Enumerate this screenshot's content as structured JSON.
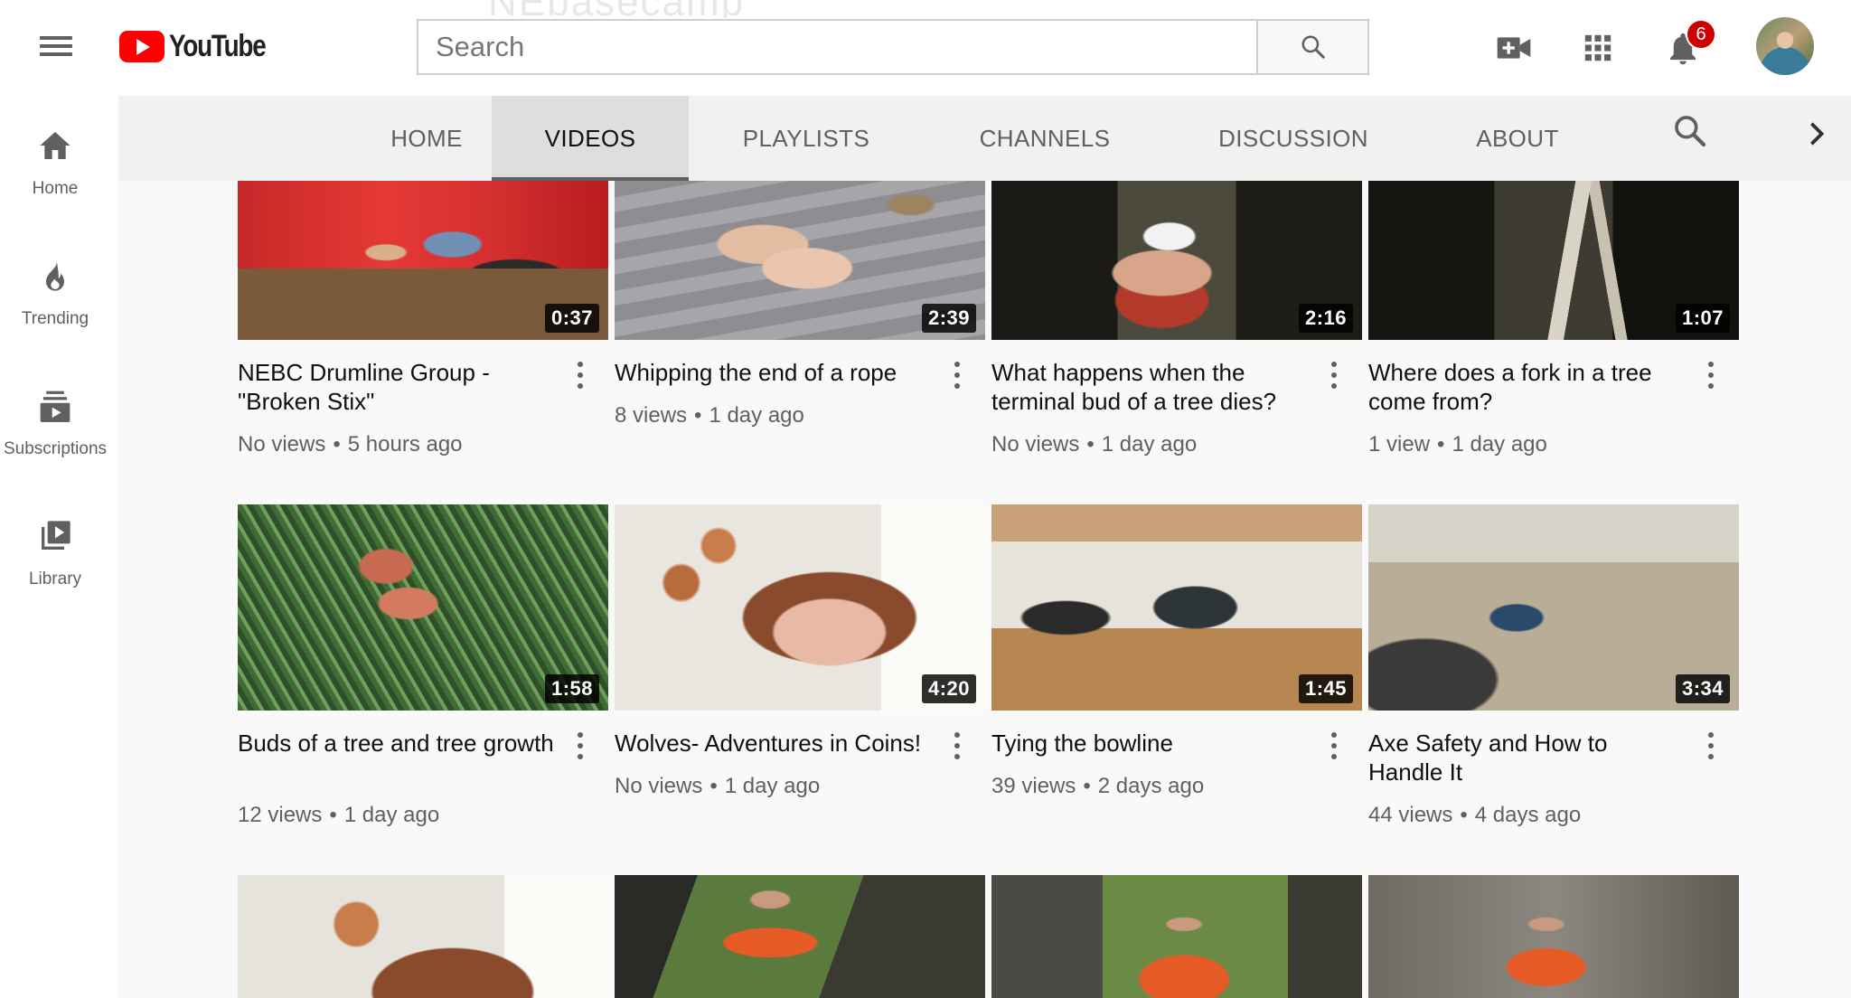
{
  "app": {
    "logo_text": "YouTube",
    "banner_ghost": "NEbasecamp"
  },
  "search": {
    "placeholder": "Search"
  },
  "notifications": {
    "count": "6"
  },
  "guide": [
    {
      "label": "Home",
      "icon": "home-icon"
    },
    {
      "label": "Trending",
      "icon": "trending-icon"
    },
    {
      "label": "Subscriptions",
      "icon": "subscriptions-icon"
    },
    {
      "label": "Library",
      "icon": "library-icon"
    }
  ],
  "tabs": [
    {
      "label": "HOME",
      "active": false
    },
    {
      "label": "VIDEOS",
      "active": true
    },
    {
      "label": "PLAYLISTS",
      "active": false
    },
    {
      "label": "CHANNELS",
      "active": false
    },
    {
      "label": "DISCUSSION",
      "active": false
    },
    {
      "label": "ABOUT",
      "active": false
    }
  ],
  "videos": [
    {
      "title": "NEBC Drumline Group - \"Broken Stix\"",
      "duration": "0:37",
      "views": "No views",
      "age": "5 hours ago"
    },
    {
      "title": "Whipping the end of a rope",
      "duration": "2:39",
      "views": "8 views",
      "age": "1 day ago"
    },
    {
      "title": "What happens when the terminal bud of a tree dies?",
      "duration": "2:16",
      "views": "No views",
      "age": "1 day ago"
    },
    {
      "title": "Where does a fork in a tree come from?",
      "duration": "1:07",
      "views": "1 view",
      "age": "1 day ago"
    },
    {
      "title": "Buds of a tree and tree growth",
      "duration": "1:58",
      "views": "12 views",
      "age": "1 day ago"
    },
    {
      "title": "Wolves- Adventures in Coins!",
      "duration": "4:20",
      "views": "No views",
      "age": "1 day ago"
    },
    {
      "title": "Tying the bowline",
      "duration": "1:45",
      "views": "39 views",
      "age": "2 days ago"
    },
    {
      "title": "Axe Safety and How to Handle It",
      "duration": "3:34",
      "views": "44 views",
      "age": "4 days ago"
    }
  ],
  "meta_separator": "•",
  "colors": {
    "brand_red": "#ff0000",
    "badge_red": "#cc0000",
    "text_secondary": "#606060",
    "tab_bar": "#f1f1f1"
  }
}
